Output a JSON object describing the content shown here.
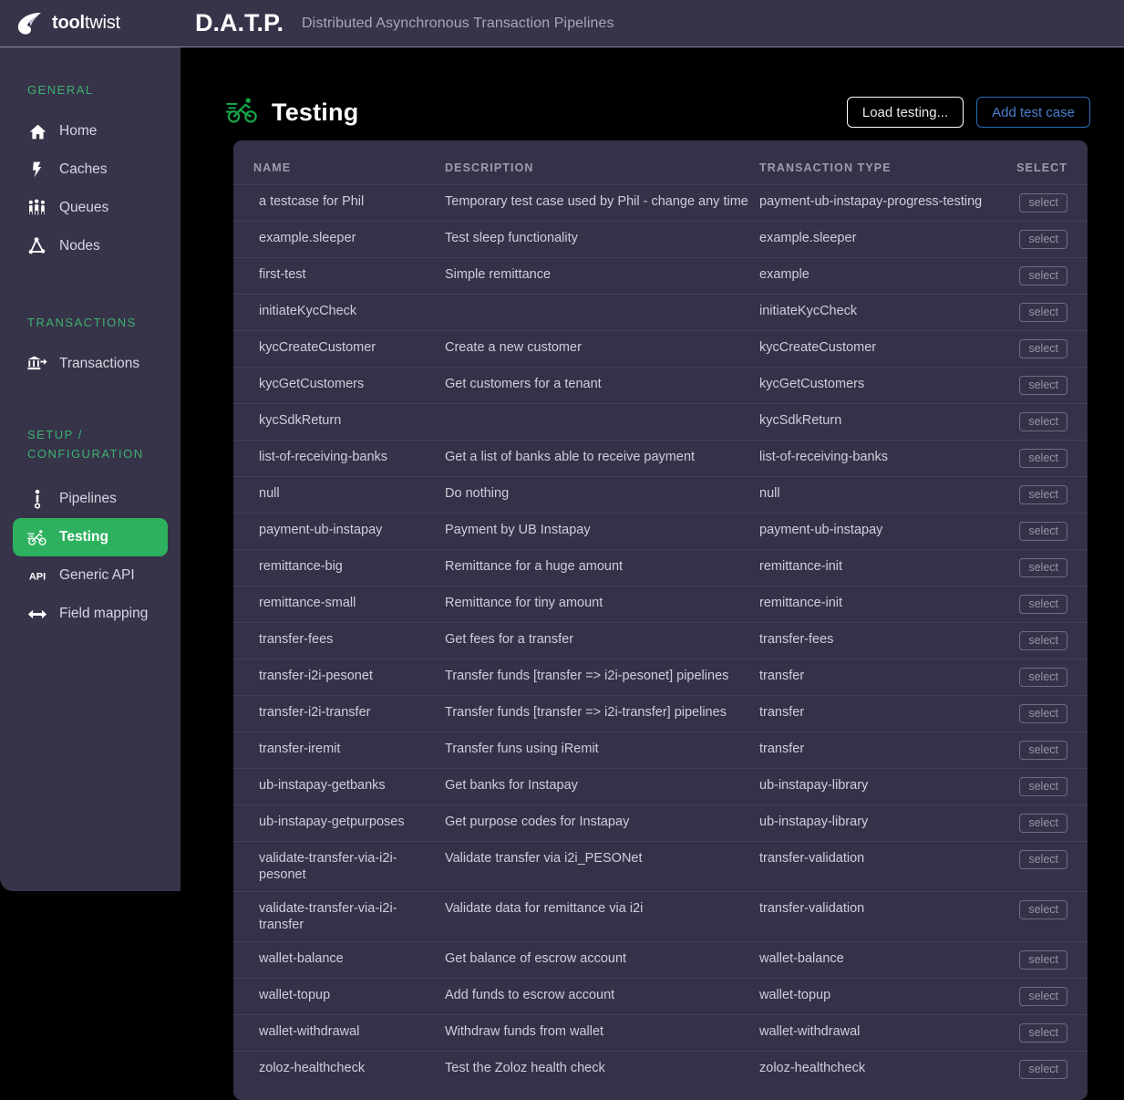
{
  "header": {
    "brand_bold": "tool",
    "brand_light": "twist",
    "logo_icon": "tooltwist-flame-logo",
    "app_abbr": "D.A.T.P.",
    "app_subtitle": "Distributed Asynchronous Transaction Pipelines",
    "bg_color": "#373349"
  },
  "sidebar": {
    "bg_color": "#373349",
    "accent_color": "#3cb371",
    "active_bg": "#2eb15f",
    "groups": [
      {
        "title": "GENERAL",
        "items": [
          {
            "label": "Home",
            "icon": "home-icon",
            "active": false
          },
          {
            "label": "Caches",
            "icon": "lightning-bolt-icon",
            "active": false
          },
          {
            "label": "Queues",
            "icon": "people-queue-icon",
            "active": false
          },
          {
            "label": "Nodes",
            "icon": "network-nodes-icon",
            "active": false
          }
        ]
      },
      {
        "title": "TRANSACTIONS",
        "items": [
          {
            "label": "Transactions",
            "icon": "bank-transfer-icon",
            "active": false
          }
        ]
      },
      {
        "title": "SETUP / CONFIGURATION",
        "items": [
          {
            "label": "Pipelines",
            "icon": "pipeline-icon",
            "active": false
          },
          {
            "label": "Testing",
            "icon": "cyclist-icon",
            "active": true
          },
          {
            "label": "Generic API",
            "icon": "api-icon",
            "active": false
          },
          {
            "label": "Field mapping",
            "icon": "double-arrow-icon",
            "active": false
          }
        ]
      }
    ]
  },
  "page": {
    "icon": "cyclist-icon",
    "title": "Testing",
    "buttons": {
      "load_testing": "Load testing...",
      "add_test_case": "Add test case"
    }
  },
  "table": {
    "columns": [
      "NAME",
      "DESCRIPTION",
      "TRANSACTION TYPE",
      "SELECT"
    ],
    "select_label": "select",
    "rows": [
      {
        "name": "a testcase for Phil",
        "description": "Temporary test case used by Phil - change any time",
        "type": "payment-ub-instapay-progress-testing"
      },
      {
        "name": "example.sleeper",
        "description": "Test sleep functionality",
        "type": "example.sleeper"
      },
      {
        "name": "first-test",
        "description": "Simple remittance",
        "type": "example"
      },
      {
        "name": "initiateKycCheck",
        "description": "",
        "type": "initiateKycCheck"
      },
      {
        "name": "kycCreateCustomer",
        "description": "Create a new customer",
        "type": "kycCreateCustomer"
      },
      {
        "name": "kycGetCustomers",
        "description": "Get customers for a tenant",
        "type": "kycGetCustomers"
      },
      {
        "name": "kycSdkReturn",
        "description": "",
        "type": "kycSdkReturn"
      },
      {
        "name": "list-of-receiving-banks",
        "description": "Get a list of banks able to receive payment",
        "type": "list-of-receiving-banks"
      },
      {
        "name": "null",
        "description": "Do nothing",
        "type": "null"
      },
      {
        "name": "payment-ub-instapay",
        "description": "Payment by UB Instapay",
        "type": "payment-ub-instapay"
      },
      {
        "name": "remittance-big",
        "description": "Remittance for a huge amount",
        "type": "remittance-init"
      },
      {
        "name": "remittance-small",
        "description": "Remittance for tiny amount",
        "type": "remittance-init"
      },
      {
        "name": "transfer-fees",
        "description": "Get fees for a transfer",
        "type": "transfer-fees"
      },
      {
        "name": "transfer-i2i-pesonet",
        "description": "Transfer funds [transfer => i2i-pesonet] pipelines",
        "type": "transfer"
      },
      {
        "name": "transfer-i2i-transfer",
        "description": "Transfer funds [transfer => i2i-transfer] pipelines",
        "type": "transfer"
      },
      {
        "name": "transfer-iremit",
        "description": "Transfer funs using iRemit",
        "type": "transfer"
      },
      {
        "name": "ub-instapay-getbanks",
        "description": "Get banks for Instapay",
        "type": "ub-instapay-library"
      },
      {
        "name": "ub-instapay-getpurposes",
        "description": "Get purpose codes for Instapay",
        "type": "ub-instapay-library"
      },
      {
        "name": "validate-transfer-via-i2i-pesonet",
        "description": "Validate transfer via i2i_PESONet",
        "type": "transfer-validation"
      },
      {
        "name": "validate-transfer-via-i2i-transfer",
        "description": "Validate data for remittance via i2i",
        "type": "transfer-validation"
      },
      {
        "name": "wallet-balance",
        "description": "Get balance of escrow account",
        "type": "wallet-balance"
      },
      {
        "name": "wallet-topup",
        "description": "Add funds to escrow account",
        "type": "wallet-topup"
      },
      {
        "name": "wallet-withdrawal",
        "description": "Withdraw funds from wallet",
        "type": "wallet-withdrawal"
      },
      {
        "name": "zoloz-healthcheck",
        "description": "Test the Zoloz health check",
        "type": "zoloz-healthcheck"
      }
    ]
  }
}
